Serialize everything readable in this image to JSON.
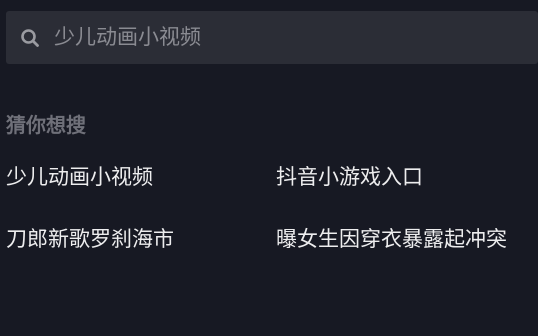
{
  "search": {
    "placeholder": "少儿动画小视频",
    "icon": "search-icon"
  },
  "suggestions_section": {
    "title": "猜你想搜",
    "items": [
      "少儿动画小视频",
      "抖音小游戏入口",
      "刀郎新歌罗刹海市",
      "曝女生因穿衣暴露起冲突"
    ]
  },
  "colors": {
    "background": "#171923",
    "search_bar": "#2b2d36",
    "placeholder": "#8a8b92",
    "section_title": "#6f7079",
    "item_text": "#ededee"
  }
}
